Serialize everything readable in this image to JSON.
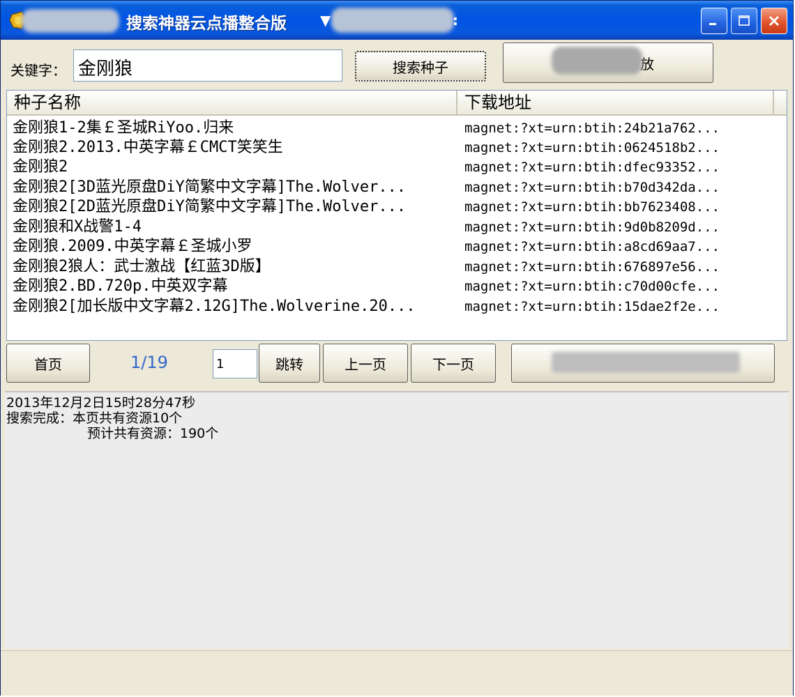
{
  "window": {
    "title": "搜索神器云点播整合版",
    "title_suffix": "▼",
    "title_tail": ":"
  },
  "search": {
    "keyword_label": "关键字：",
    "keyword_value": "金刚狼",
    "search_button": "搜索种子",
    "play_button_tail": "放"
  },
  "list": {
    "columns": [
      "种子名称",
      "下载地址"
    ],
    "rows": [
      {
        "name": "金刚狼1-2集￡圣城RiYoo.归来",
        "url": "magnet:?xt=urn:btih:24b21a762..."
      },
      {
        "name": "金刚狼2.2013.中英字幕￡CMCT笑笑生",
        "url": "magnet:?xt=urn:btih:0624518b2..."
      },
      {
        "name": "金刚狼2",
        "url": "magnet:?xt=urn:btih:dfec93352..."
      },
      {
        "name": "金刚狼2[3D蓝光原盘DiY简繁中文字幕]The.Wolver...",
        "url": "magnet:?xt=urn:btih:b70d342da..."
      },
      {
        "name": "金刚狼2[2D蓝光原盘DiY简繁中文字幕]The.Wolver...",
        "url": "magnet:?xt=urn:btih:bb7623408..."
      },
      {
        "name": "金刚狼和X战警1-4",
        "url": "magnet:?xt=urn:btih:9d0b8209d..."
      },
      {
        "name": "金刚狼.2009.中英字幕￡圣城小罗",
        "url": "magnet:?xt=urn:btih:a8cd69aa7..."
      },
      {
        "name": "金刚狼2狼人：武士激战【红蓝3D版】",
        "url": "magnet:?xt=urn:btih:676897e56..."
      },
      {
        "name": "金刚狼2.BD.720p.中英双字幕",
        "url": "magnet:?xt=urn:btih:c70d00cfe..."
      },
      {
        "name": "金刚狼2[加长版中文字幕2.12G]The.Wolverine.20...",
        "url": "magnet:?xt=urn:btih:15dae2f2e..."
      }
    ]
  },
  "pager": {
    "first_button": "首页",
    "page_indicator": "1/19",
    "page_input_value": "1",
    "jump_button": "跳转",
    "prev_button": "上一页",
    "next_button": "下一页"
  },
  "log": {
    "timestamp": "2013年12月2日15时28分47秒",
    "line1": "搜索完成：本页共有资源10个",
    "line2": "预计共有资源：190个"
  },
  "colors": {
    "title_bar": "#0054e3",
    "page_indicator": "#3366cc",
    "close_button": "#e2552d"
  }
}
